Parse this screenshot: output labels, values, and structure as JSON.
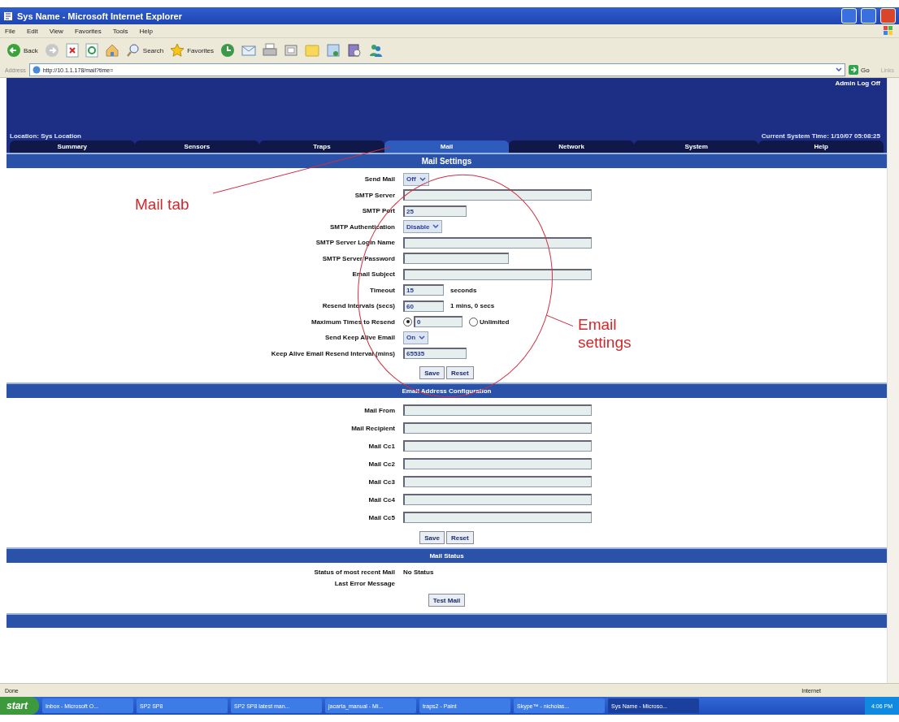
{
  "window": {
    "title": "Sys Name - Microsoft Internet Explorer"
  },
  "menu": [
    "File",
    "Edit",
    "View",
    "Favorites",
    "Tools",
    "Help"
  ],
  "toolbar": [
    {
      "kind": "back",
      "label": "Back"
    },
    {
      "kind": "forward"
    },
    {
      "kind": "stop"
    },
    {
      "kind": "refresh"
    },
    {
      "kind": "home"
    },
    {
      "kind": "search",
      "label": "Search"
    },
    {
      "kind": "favorites",
      "label": "Favorites"
    },
    {
      "kind": "history"
    },
    {
      "kind": "mail"
    },
    {
      "kind": "print"
    },
    {
      "kind": "edit"
    },
    {
      "kind": "folder"
    },
    {
      "kind": "research"
    },
    {
      "kind": "media"
    },
    {
      "kind": "messenger"
    }
  ],
  "address": {
    "label": "Address",
    "url": "http://10.1.1.178/mail?time=",
    "go": "Go",
    "links": "Links"
  },
  "header": {
    "user_link": "Admin Log Off",
    "location": "Location: Sys Location",
    "time": "Current System Time: 1/10/07 05:08:25"
  },
  "tabs": [
    {
      "label": "Summary",
      "selected": false
    },
    {
      "label": "Sensors",
      "selected": false
    },
    {
      "label": "Traps",
      "selected": false
    },
    {
      "label": "Mail",
      "selected": true
    },
    {
      "label": "Network",
      "selected": false
    },
    {
      "label": "System",
      "selected": false
    },
    {
      "label": "Help",
      "selected": false
    }
  ],
  "mail_settings": {
    "title": "Mail Settings",
    "fields": [
      {
        "label": "Send Mail",
        "kind": "select",
        "value": "Off"
      },
      {
        "label": "SMTP Server",
        "kind": "text"
      },
      {
        "label": "SMTP Port",
        "kind": "number",
        "value": "25"
      },
      {
        "label": "SMTP Authentication",
        "kind": "select",
        "value": "Disable"
      },
      {
        "label": "SMTP Server Login Name",
        "kind": "text"
      },
      {
        "label": "SMTP Server Password",
        "kind": "password"
      },
      {
        "label": "Email Subject",
        "kind": "text"
      },
      {
        "label": "Timeout",
        "kind": "number",
        "value": "15",
        "suffix": "seconds"
      },
      {
        "label": "Resend Intervals (secs)",
        "kind": "number",
        "value": "60",
        "suffix": "1 mins, 0 secs"
      },
      {
        "label": "Maximum Times to Resend",
        "kind": "radio",
        "value": "0",
        "selected": true,
        "option": "Unlimited",
        "option_selected": false
      },
      {
        "label": "Send Keep Alive Email",
        "kind": "select",
        "value": "On"
      },
      {
        "label": "Keep Alive Email Resend Interval (mins)",
        "kind": "number",
        "value": "65535"
      }
    ],
    "buttons": [
      "Save",
      "Reset"
    ]
  },
  "email_addresses": {
    "title": "Email Address Configuration",
    "fields": [
      {
        "label": "Mail From",
        "kind": "text"
      },
      {
        "label": "Mail Recipient",
        "kind": "text"
      },
      {
        "label": "Mail Cc1",
        "kind": "text"
      },
      {
        "label": "Mail Cc2",
        "kind": "text"
      },
      {
        "label": "Mail Cc3",
        "kind": "text"
      },
      {
        "label": "Mail Cc4",
        "kind": "text"
      },
      {
        "label": "Mail Cc5",
        "kind": "text"
      }
    ],
    "buttons": [
      "Save",
      "Reset"
    ]
  },
  "mail_status": {
    "title": "Mail Status",
    "rows": [
      {
        "label": "Status of most recent Mail",
        "value": "No Status"
      },
      {
        "label": "Last Error Message"
      }
    ],
    "button": "Test Mail"
  },
  "annotations": [
    {
      "kind": "tab",
      "text": "Mail tab"
    },
    {
      "kind": "settings",
      "text": "Email settings"
    }
  ],
  "status_bar": {
    "text": "Done",
    "zone": "Internet"
  },
  "taskbar": {
    "start": "start",
    "items": [
      {
        "label": "Inbox - Microsoft O...",
        "selected": false
      },
      {
        "label": "SP2 SP8",
        "selected": false
      },
      {
        "label": "SP2 SP8 latest man...",
        "selected": false
      },
      {
        "label": "jacarta_manual - Mi...",
        "selected": false
      },
      {
        "label": "traps2 - Paint",
        "selected": false
      },
      {
        "label": "Skype™ - nicholas...",
        "selected": false
      },
      {
        "label": "Sys Name - Microso...",
        "selected": true
      }
    ],
    "clock": "4:06 PM"
  }
}
